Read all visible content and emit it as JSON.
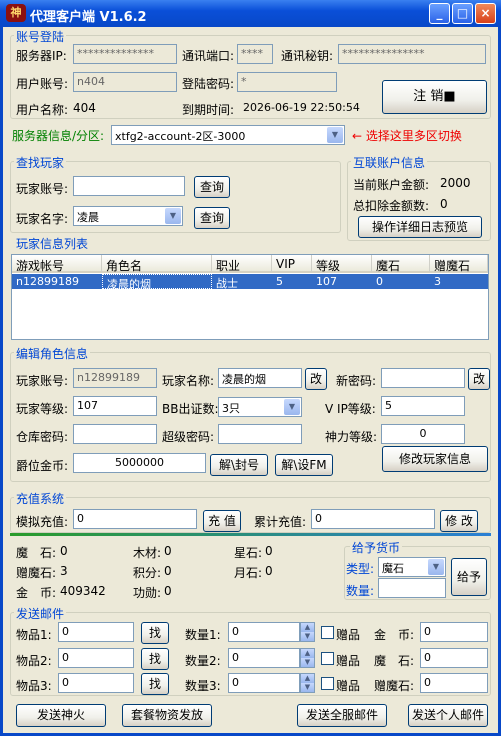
{
  "window": {
    "title": "代理客户端 V1.6.2",
    "logo_text": "神",
    "min_glyph": "_",
    "max_glyph": "□",
    "close_glyph": "×"
  },
  "login": {
    "group_title": "账号登陆",
    "server_ip_label": "服务器IP:",
    "server_ip_value": "**************",
    "port_label": "通讯端口:",
    "port_value": "****",
    "secret_label": "通讯秘钥:",
    "secret_value": "***************",
    "user_account_label": "用户账号:",
    "user_account_value": "n404",
    "password_label": "登陆密码:",
    "password_value": "*",
    "user_name_label": "用户名称:",
    "user_name_value": "404",
    "expire_label": "到期时间:",
    "expire_value": "2026-06-19 22:50:54",
    "logout_button": "注 销■"
  },
  "server_select": {
    "label": "服务器信息/分区:",
    "value": "xtfg2-account-2区-3000",
    "hint": "← 选择这里多区切换"
  },
  "find_player": {
    "group_title": "查找玩家",
    "account_label": "玩家账号:",
    "account_value": "",
    "name_label": "玩家名字:",
    "name_value": "凌晨",
    "query_button": "查询",
    "query_button2": "查询"
  },
  "account_info": {
    "group_title": "互联账户信息",
    "balance_label": "当前账户金额:",
    "balance_value": "2000",
    "total_label": "总扣除金额数:",
    "total_value": "0",
    "log_button": "操作详细日志预览"
  },
  "player_list": {
    "group_title": "玩家信息列表",
    "columns": [
      "游戏帐号",
      "角色名",
      "职业",
      "VIP",
      "等级",
      "魔石",
      "赠魔石"
    ],
    "rows": [
      [
        "n12899189",
        "凌晨的烟",
        "战士",
        "5",
        "107",
        "0",
        "3"
      ]
    ]
  },
  "edit_role": {
    "group_title": "编辑角色信息",
    "account_label": "玩家账号:",
    "account_value": "n12899189",
    "name_label": "玩家名称:",
    "name_value": "凌晨的烟",
    "name_btn": "改",
    "newpwd_label": "新密码:",
    "newpwd_value": "",
    "newpwd_btn": "改",
    "level_label": "玩家等级:",
    "level_value": "107",
    "bb_label": "BB出证数:",
    "bb_value": "3只",
    "vip_label": "V IP等级:",
    "vip_value": "5",
    "warehouse_label": "仓库密码:",
    "warehouse_value": "",
    "superpwd_label": "超级密码:",
    "superpwd_value": "",
    "power_label": "神力等级:",
    "power_value": "0",
    "gold_label": "爵位金币:",
    "gold_value": "5000000",
    "unseal_btn": "解\\封号",
    "unset_gm_btn": "解\\设FM",
    "modify_btn": "修改玩家信息"
  },
  "recharge": {
    "group_title": "充值系统",
    "sim_label": "模拟充值:",
    "sim_value": "0",
    "sim_btn": "充 值",
    "total_label": "累计充值:",
    "total_value": "0",
    "modify_btn": "修 改"
  },
  "currency": {
    "mostone_label": "魔　石:",
    "mostone_value": "0",
    "wood_label": "木材:",
    "wood_value": "0",
    "star_label": "星石:",
    "star_value": "0",
    "gift_label": "赠魔石:",
    "gift_value": "3",
    "score_label": "积分:",
    "score_value": "0",
    "moon_label": "月石:",
    "moon_value": "0",
    "gold_label": "金　币:",
    "gold_value": "409342",
    "merit_label": "功勋:",
    "merit_value": "0"
  },
  "give_currency": {
    "group_title": "给予货币",
    "type_label": "类型:",
    "type_value": "魔石",
    "amount_label": "数量:",
    "amount_value": "",
    "give_btn": "给予"
  },
  "mail": {
    "group_title": "发送邮件",
    "rows": [
      {
        "item_label": "物品1:",
        "item_value": "0",
        "find": "找",
        "qty_label": "数量1:",
        "qty_value": "0",
        "gift": "赠品",
        "cur_label": "金　币:",
        "cur_value": "0"
      },
      {
        "item_label": "物品2:",
        "item_value": "0",
        "find": "找",
        "qty_label": "数量2:",
        "qty_value": "0",
        "gift": "赠品",
        "cur_label": "魔　石:",
        "cur_value": "0"
      },
      {
        "item_label": "物品3:",
        "item_value": "0",
        "find": "找",
        "qty_label": "数量3:",
        "qty_value": "0",
        "gift": "赠品",
        "cur_label": "赠魔石:",
        "cur_value": "0"
      }
    ],
    "btn_fire": "发送神火",
    "btn_pack": "套餐物资发放",
    "btn_all": "发送全服邮件",
    "btn_personal": "发送个人邮件"
  },
  "colors": {
    "accent": "#0046d5",
    "title_bar": "#0a4fd8",
    "selection": "#316ac5",
    "hint": "#ee0000"
  }
}
